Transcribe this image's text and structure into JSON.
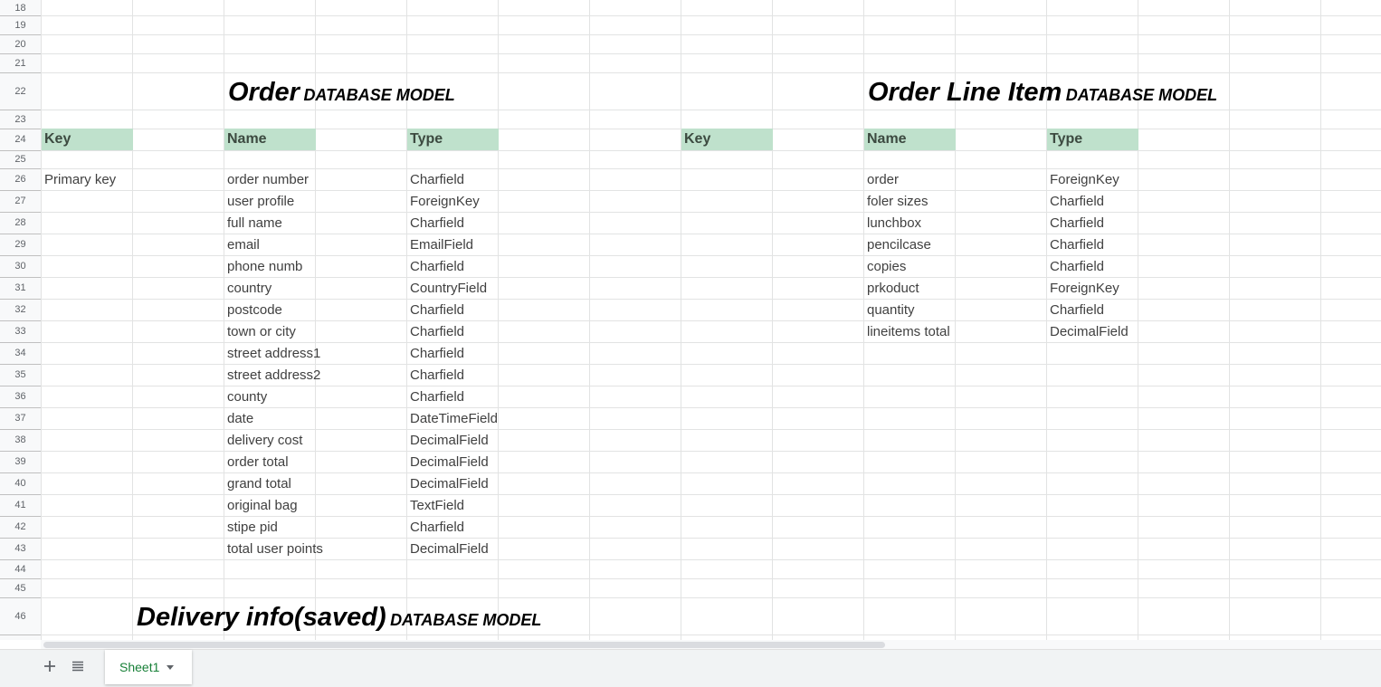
{
  "rows": [
    "18",
    "19",
    "20",
    "21",
    "22",
    "23",
    "24",
    "25",
    "26",
    "27",
    "28",
    "29",
    "30",
    "31",
    "32",
    "33",
    "34",
    "35",
    "36",
    "37",
    "38",
    "39",
    "40",
    "41",
    "42",
    "43",
    "44",
    "45",
    "46"
  ],
  "order": {
    "title": "Order",
    "subtitle": "DATABASE MODEL",
    "headers": {
      "key": "Key",
      "name": "Name",
      "type": "Type"
    },
    "primary_key": "Primary key",
    "fields": [
      {
        "name": "order number",
        "type": "Charfield"
      },
      {
        "name": "user profile",
        "type": "ForeignKey"
      },
      {
        "name": "full name",
        "type": "Charfield"
      },
      {
        "name": "email",
        "type": "EmailField"
      },
      {
        "name": "phone numb",
        "type": "Charfield"
      },
      {
        "name": "country",
        "type": "CountryField"
      },
      {
        "name": "postcode",
        "type": "Charfield"
      },
      {
        "name": "town or city",
        "type": "Charfield"
      },
      {
        "name": "street address1",
        "type": "Charfield"
      },
      {
        "name": "street address2",
        "type": "Charfield"
      },
      {
        "name": "county",
        "type": "Charfield"
      },
      {
        "name": "date",
        "type": "DateTimeField"
      },
      {
        "name": "delivery cost",
        "type": "DecimalField"
      },
      {
        "name": "order total",
        "type": "DecimalField"
      },
      {
        "name": "grand total",
        "type": "DecimalField"
      },
      {
        "name": "original bag",
        "type": "TextField"
      },
      {
        "name": "stipe pid",
        "type": "Charfield"
      },
      {
        "name": "total user points",
        "type": "DecimalField"
      }
    ]
  },
  "line_item": {
    "title": "Order Line Item",
    "subtitle": "DATABASE MODEL",
    "headers": {
      "key": "Key",
      "name": "Name",
      "type": "Type"
    },
    "fields": [
      {
        "name": "order",
        "type": "ForeignKey"
      },
      {
        "name": "foler sizes",
        "type": "Charfield"
      },
      {
        "name": "lunchbox",
        "type": "Charfield"
      },
      {
        "name": "pencilcase",
        "type": "Charfield"
      },
      {
        "name": "copies",
        "type": "Charfield"
      },
      {
        "name": "prkoduct",
        "type": "ForeignKey"
      },
      {
        "name": "quantity",
        "type": "Charfield"
      },
      {
        "name": "lineitems total",
        "type": "DecimalField"
      }
    ]
  },
  "delivery": {
    "title": "Delivery info(saved)",
    "subtitle": "DATABASE MODEL"
  },
  "tabbar": {
    "sheet_name": "Sheet1",
    "add_icon": "plus-icon",
    "list_icon": "all-sheets-icon",
    "dropdown_icon": "caret-down-icon"
  },
  "colors": {
    "header_fill": "#bfe1cc",
    "active_tab_text": "#188038"
  }
}
